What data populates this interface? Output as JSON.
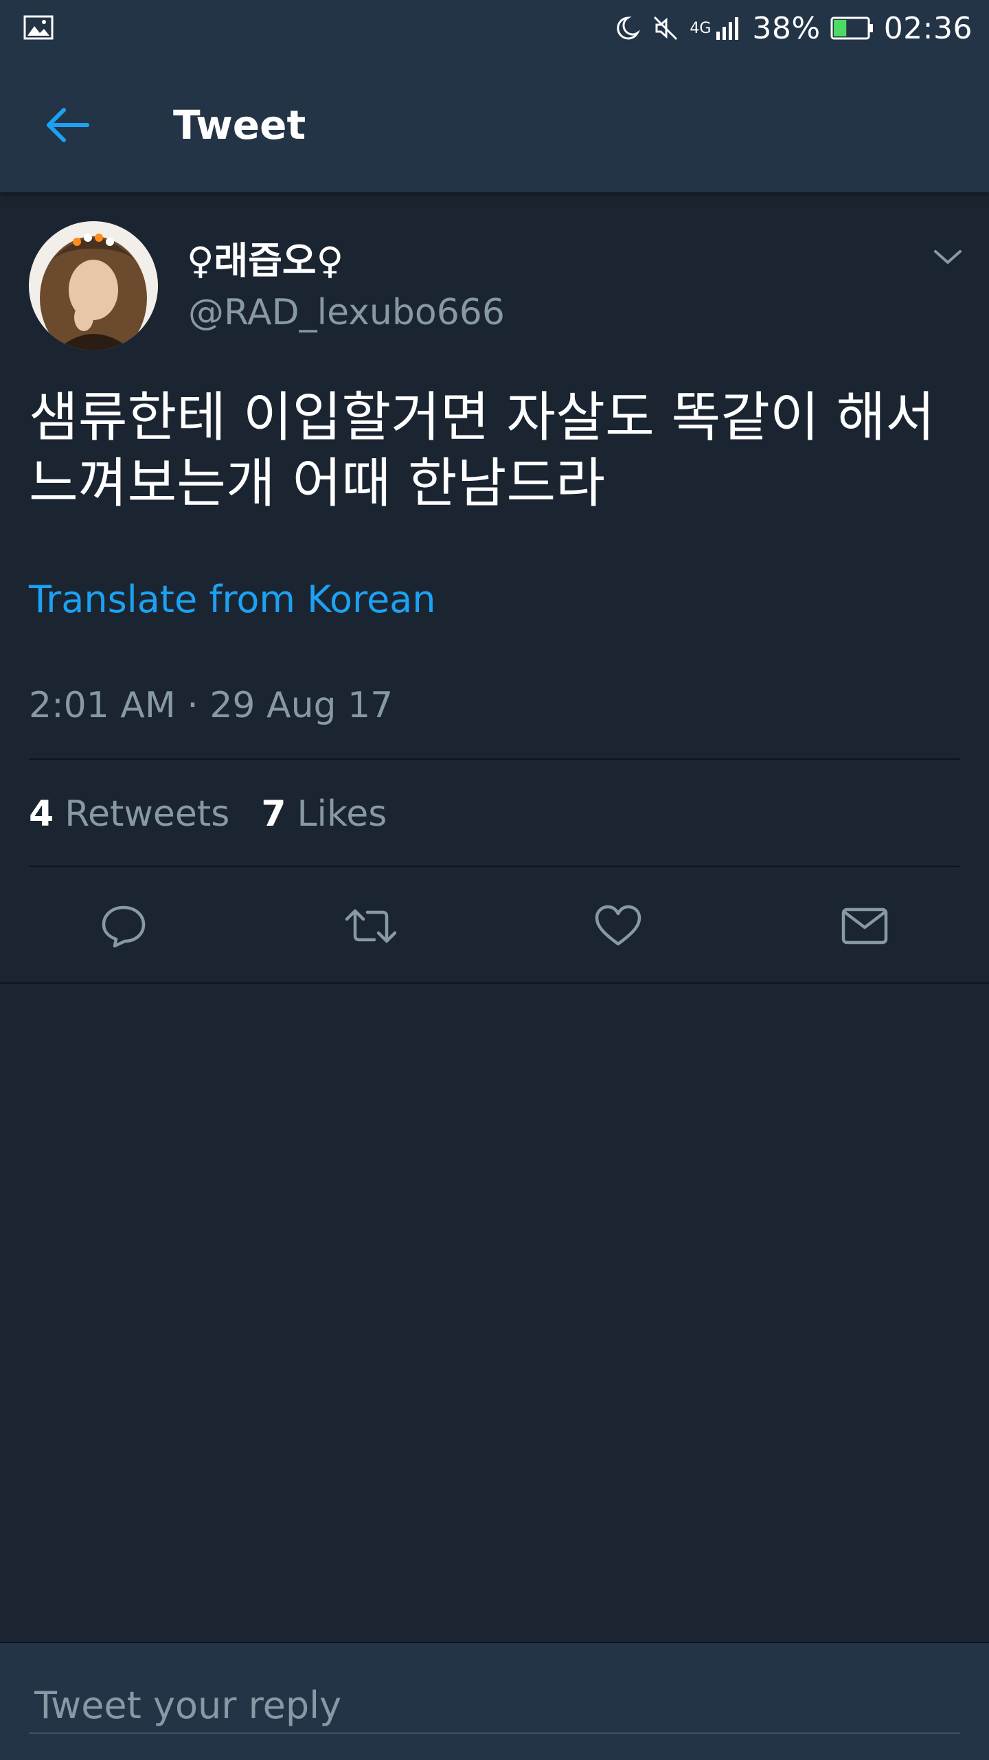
{
  "status_bar": {
    "network_type": "4G",
    "battery_percent": "38%",
    "battery_level": 0.38,
    "time": "02:36",
    "icons": [
      "gallery-icon",
      "moon-icon",
      "mute-icon",
      "signal-icon",
      "battery-icon"
    ]
  },
  "app_bar": {
    "title": "Tweet",
    "back_icon": "back-arrow-icon"
  },
  "tweet": {
    "display_name": "♀래즙오♀",
    "handle": "@RAD_lexubo666",
    "text": "샘류한테 이입할거면 자살도 똑같이 해서 느껴보는개 어때 한남드라",
    "translate_label": "Translate from Korean",
    "timestamp": "2:01 AM · 29 Aug 17",
    "stats": {
      "retweets_count": "4",
      "retweets_label": "Retweets",
      "likes_count": "7",
      "likes_label": "Likes"
    },
    "actions": [
      "reply-icon",
      "retweet-icon",
      "like-icon",
      "direct-message-icon"
    ]
  },
  "reply": {
    "placeholder": "Tweet your reply"
  },
  "colors": {
    "background": "#1b2531",
    "bar": "#243447",
    "accent": "#1da1f2",
    "muted": "#8899a6",
    "battery": "#4cd964"
  }
}
